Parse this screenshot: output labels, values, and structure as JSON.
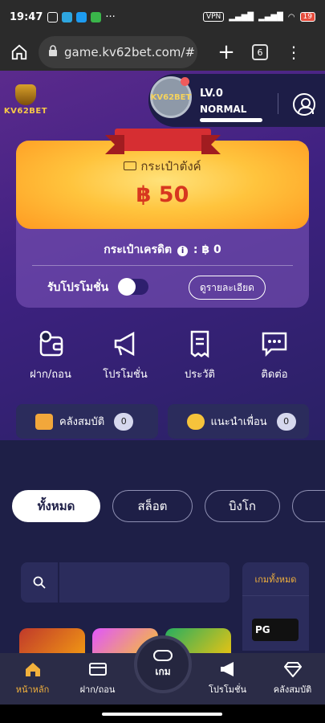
{
  "statusbar": {
    "time": "19:47",
    "vpn": "VPN",
    "battery": "19",
    "more": "···"
  },
  "browser": {
    "url": "game.kv62bet.com/#",
    "tab_count": "6"
  },
  "header": {
    "logo_text": "KV62BET",
    "level": "LV.0",
    "rank": "NORMAL",
    "avatar_badge": "KV62BET"
  },
  "wallet": {
    "title": "กระเป๋าตังค์",
    "balance": "฿ 50"
  },
  "credit": {
    "label": "กระเป๋าเครดิต",
    "value": ": ฿ 0"
  },
  "promotion": {
    "label": "รับโปรโมชั่น",
    "detail_button": "ดูรายละเอียด",
    "enabled": false
  },
  "actions": [
    {
      "label": "ฝาก/ถอน",
      "icon": "wallet-icon"
    },
    {
      "label": "โปรโมชั่น",
      "icon": "megaphone-icon"
    },
    {
      "label": "ประวัติ",
      "icon": "receipt-icon"
    },
    {
      "label": "ติดต่อ",
      "icon": "chat-icon"
    }
  ],
  "chips": [
    {
      "label": "คลังสมบัติ",
      "count": "0",
      "icon": "treasure-icon"
    },
    {
      "label": "แนะนำเพื่อน",
      "count": "0",
      "icon": "friends-icon"
    }
  ],
  "categories": [
    "ทั้งหมด",
    "สล็อต",
    "บิงโก"
  ],
  "search": {
    "placeholder": ""
  },
  "all_games": {
    "title": "เกมทั้งหมด",
    "provider": "PG"
  },
  "bottom_nav": [
    {
      "label": "หน้าหลัก",
      "icon": "home-icon",
      "active": true
    },
    {
      "label": "ฝาก/ถอน",
      "icon": "card-icon"
    },
    {
      "label": "เกม",
      "icon": "gamepad-icon"
    },
    {
      "label": "โปรโมชั่น",
      "icon": "megaphone-icon"
    },
    {
      "label": "คลังสมบัติ",
      "icon": "diamond-icon"
    }
  ],
  "colors": {
    "accent": "#f2b13c",
    "background": "#1e1f47",
    "balance": "#d7371f"
  }
}
